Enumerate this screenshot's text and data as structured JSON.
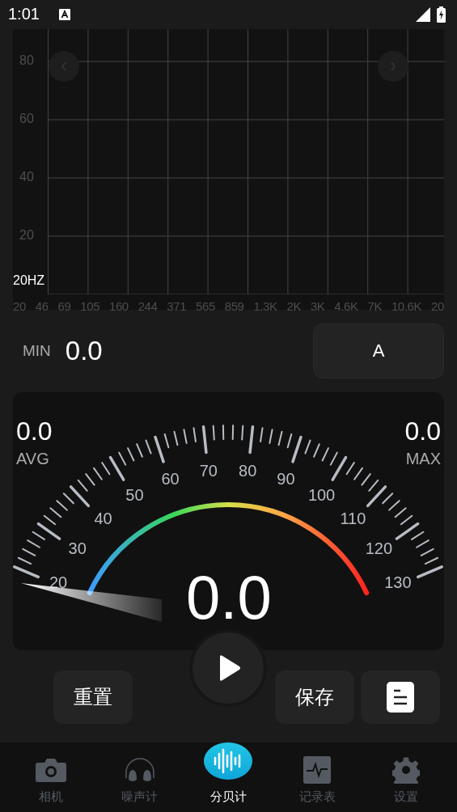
{
  "status_bar": {
    "time": "1:01"
  },
  "spectrum": {
    "y_labels": [
      "80",
      "60",
      "40",
      "20"
    ],
    "band_label": "20HZ",
    "x_labels": [
      "20",
      "46",
      "69",
      "105",
      "160",
      "244",
      "371",
      "565",
      "859",
      "1.3K",
      "2K",
      "3K",
      "4.6K",
      "7K",
      "10.6K",
      "20"
    ]
  },
  "min": {
    "label": "MIN",
    "value": "0.0"
  },
  "weighting": {
    "label": "A"
  },
  "gauge": {
    "avg_value": "0.0",
    "avg_label": "AVG",
    "max_value": "0.0",
    "max_label": "MAX",
    "reading": "0.0",
    "scale_labels": [
      "20",
      "30",
      "40",
      "50",
      "60",
      "70",
      "80",
      "90",
      "100",
      "110",
      "120",
      "130"
    ]
  },
  "actions": {
    "reset": "重置",
    "save": "保存"
  },
  "nav": [
    {
      "kind": "camera",
      "label": "相机",
      "selected": false
    },
    {
      "kind": "headphones",
      "label": "噪声计",
      "selected": false
    },
    {
      "kind": "wave",
      "label": "分贝计",
      "selected": true
    },
    {
      "kind": "chart",
      "label": "记录表",
      "selected": false
    },
    {
      "kind": "gear",
      "label": "设置",
      "selected": false
    }
  ]
}
